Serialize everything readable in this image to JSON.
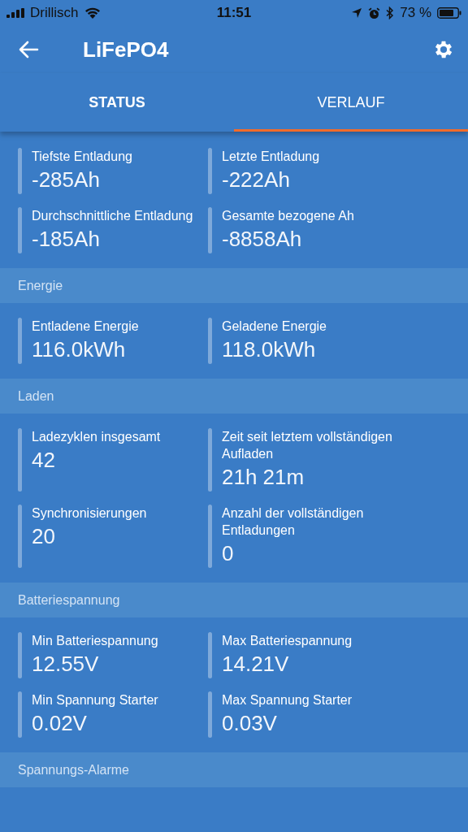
{
  "status_bar": {
    "carrier": "Drillisch",
    "time": "11:51",
    "battery": "73 %"
  },
  "header": {
    "title": "LiFePO4"
  },
  "tabs": [
    {
      "label": "STATUS",
      "selected": false
    },
    {
      "label": "VERLAUF",
      "selected": true
    }
  ],
  "sections": [
    {
      "items": [
        {
          "label": "Tiefste Entladung",
          "value": "-285Ah"
        },
        {
          "label": "Letzte Entladung",
          "value": "-222Ah"
        },
        {
          "label": "Durchschnittliche Entladung",
          "value": "-185Ah"
        },
        {
          "label": "Gesamte bezogene Ah",
          "value": "-8858Ah"
        }
      ]
    },
    {
      "title": "Energie",
      "items": [
        {
          "label": "Entladene Energie",
          "value": "116.0kWh"
        },
        {
          "label": "Geladene Energie",
          "value": "118.0kWh"
        }
      ]
    },
    {
      "title": "Laden",
      "items": [
        {
          "label": "Ladezyklen insgesamt",
          "value": "42"
        },
        {
          "label": "Zeit seit letztem vollständigen Aufladen",
          "value": "21h 21m"
        },
        {
          "label": "Synchronisierungen",
          "value": "20"
        },
        {
          "label": "Anzahl der vollständigen Entladungen",
          "value": "0"
        }
      ]
    },
    {
      "title": "Batteriespannung",
      "items": [
        {
          "label": "Min Batteriespannung",
          "value": "12.55V"
        },
        {
          "label": "Max Batteriespannung",
          "value": "14.21V"
        },
        {
          "label": "Min Spannung Starter",
          "value": "0.02V"
        },
        {
          "label": "Max Spannung Starter",
          "value": "0.03V"
        }
      ]
    },
    {
      "title": "Spannungs-Alarme"
    }
  ]
}
